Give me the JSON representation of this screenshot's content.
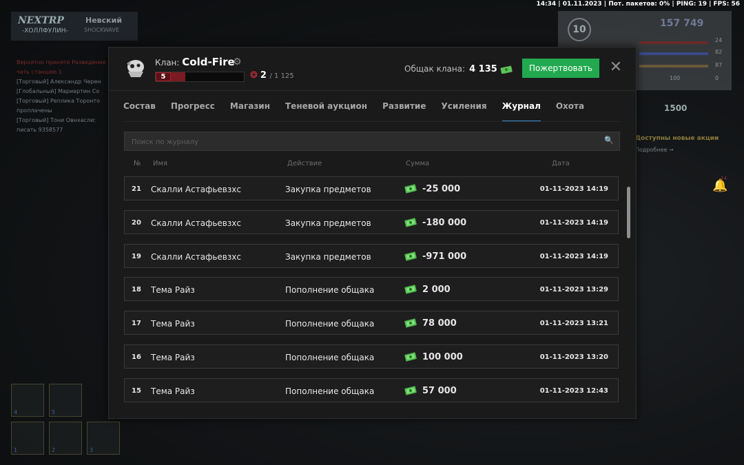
{
  "hud": {
    "status_bar": "14:34 | 01.11.2023 | Пот. пакетов: 0% | PING: 19 | FPS: 56",
    "logo_brand": "NEXTRP",
    "logo_sub": "-ХОЛЛФУЛИН-",
    "server_name": "Невский",
    "server_sub": "SHOCKWAVE",
    "player_level": "10",
    "player_money": "157 749",
    "stats": [
      "24",
      "82",
      "87",
      "0"
    ],
    "stat_extra": "100",
    "weapon_ammo": "1500",
    "promo_title": "Доступны новые акции",
    "promo_more": "Подробнее",
    "bell_count": "14",
    "chat": [
      {
        "text": "Вероятно приняте Разведение",
        "tone": "red"
      },
      {
        "text": "чать станцию 1",
        "tone": "red"
      },
      {
        "text": "[Торговый] Александр Черен",
        "tone": "gray"
      },
      {
        "text": "[Глобальный] Мариартин Со",
        "tone": "gray"
      },
      {
        "text": "[Торговый] Реплика Торонто",
        "tone": "gray"
      },
      {
        "text": "проплачены",
        "tone": "gray"
      },
      {
        "text": "[Торговый] Тони Овнхасли:",
        "tone": "gray"
      },
      {
        "text": "писать 9358577",
        "tone": "gray"
      }
    ],
    "slots": [
      "4",
      "5",
      "1",
      "2",
      "3"
    ]
  },
  "modal": {
    "clan_label": "Клан:",
    "clan_name": "Cold-Fire",
    "clan_level": "5",
    "clan_level_progress": 0.2,
    "members_online": "2",
    "members_total": "/ 1 125",
    "treasury_label": "Общак клана:",
    "treasury_value": "4 135",
    "donate_label": "Пожертвовать",
    "tabs": [
      {
        "label": "Состав",
        "active": false
      },
      {
        "label": "Прогресс",
        "active": false
      },
      {
        "label": "Магазин",
        "active": false
      },
      {
        "label": "Теневой аукцион",
        "active": false
      },
      {
        "label": "Развитие",
        "active": false
      },
      {
        "label": "Усиления",
        "active": false
      },
      {
        "label": "Журнал",
        "active": true
      },
      {
        "label": "Охота",
        "active": false
      }
    ],
    "search_placeholder": "Поиск по журналу",
    "columns": {
      "no": "№",
      "name": "Имя",
      "action": "Действие",
      "sum": "Сумма",
      "date": "Дата"
    },
    "rows": [
      {
        "no": "21",
        "name": "Скалли Астафьевзхс",
        "action": "Закупка предметов",
        "sum": "-25 000",
        "date": "01-11-2023 14:19"
      },
      {
        "no": "20",
        "name": "Скалли Астафьевзхс",
        "action": "Закупка предметов",
        "sum": "-180 000",
        "date": "01-11-2023 14:19"
      },
      {
        "no": "19",
        "name": "Скалли Астафьевзхс",
        "action": "Закупка предметов",
        "sum": "-971 000",
        "date": "01-11-2023 14:19"
      },
      {
        "no": "18",
        "name": "Тема Райз",
        "action": "Пополнение общака",
        "sum": "2 000",
        "date": "01-11-2023 13:29"
      },
      {
        "no": "17",
        "name": "Тема Райз",
        "action": "Пополнение общака",
        "sum": "78 000",
        "date": "01-11-2023 13:21"
      },
      {
        "no": "16",
        "name": "Тема Райз",
        "action": "Пополнение общака",
        "sum": "100 000",
        "date": "01-11-2023 13:20"
      },
      {
        "no": "15",
        "name": "Тема Райз",
        "action": "Пополнение общака",
        "sum": "57 000",
        "date": "01-11-2023 12:43"
      }
    ]
  },
  "colors": {
    "accent": "#3c8ed8",
    "donate": "#22a94f",
    "money": "#6fd36a",
    "clan_red": "#b3202a"
  }
}
